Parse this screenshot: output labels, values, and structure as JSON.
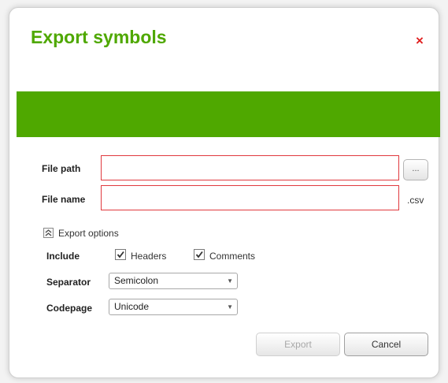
{
  "dialog": {
    "title": "Export symbols",
    "close_glyph": "×"
  },
  "form": {
    "file_path_label": "File path",
    "file_path_value": "",
    "browse_label": "...",
    "file_name_label": "File name",
    "file_name_value": "",
    "file_extension": ".csv"
  },
  "options": {
    "toggle_label": "Export options",
    "include_label": "Include",
    "headers_label": "Headers",
    "headers_checked": true,
    "comments_label": "Comments",
    "comments_checked": true,
    "separator_label": "Separator",
    "separator_value": "Semicolon",
    "codepage_label": "Codepage",
    "codepage_value": "Unicode"
  },
  "buttons": {
    "export_label": "Export",
    "cancel_label": "Cancel"
  },
  "colors": {
    "accent": "#4fa800",
    "error_border": "#e0393e",
    "close": "#e02020"
  },
  "icons": {
    "toggle": "collapse-icon",
    "close": "close-icon",
    "dropdown": "chevron-down-icon",
    "check": "checkmark-icon"
  }
}
